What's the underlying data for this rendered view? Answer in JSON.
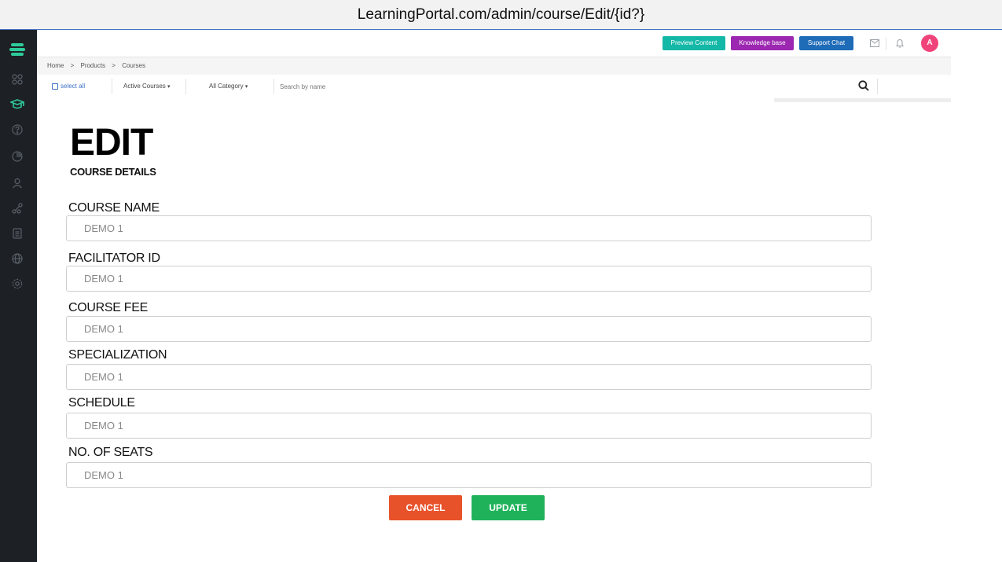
{
  "browser": {
    "url": "LearningPortal.com/admin/course/Edit/{id?}"
  },
  "sidebar": {
    "items": [
      {
        "icon": "menu-logo-icon"
      },
      {
        "icon": "dashboard-icon"
      },
      {
        "icon": "graduation-cap-icon"
      },
      {
        "icon": "help-icon"
      },
      {
        "icon": "chart-icon"
      },
      {
        "icon": "user-icon"
      },
      {
        "icon": "share-icon"
      },
      {
        "icon": "document-icon"
      },
      {
        "icon": "globe-icon"
      },
      {
        "icon": "settings-icon"
      }
    ],
    "accent": "#2ecc9a"
  },
  "topbar": {
    "preview_label": "Preview Content",
    "knowledge_label": "Knowledge base",
    "support_label": "Support Chat",
    "avatar_initial": "A",
    "colors": {
      "preview": "#14b8a6",
      "knowledge": "#9c27b0",
      "support": "#1e6bb8",
      "avatar": "#f0437a"
    }
  },
  "breadcrumb": {
    "items": [
      "Home",
      ">",
      "Products",
      ">",
      "Courses"
    ]
  },
  "filters": {
    "select_all": "select all",
    "active_courses": "Active Courses",
    "all_category": "All Category",
    "search_placeholder": "Search by name"
  },
  "page": {
    "title": "EDIT",
    "subtitle": "COURSE DETAILS"
  },
  "form": {
    "fields": [
      {
        "label": "COURSE NAME",
        "value": "DEMO 1"
      },
      {
        "label": "FACILITATOR ID",
        "value": "DEMO 1"
      },
      {
        "label": "COURSE FEE",
        "value": "DEMO 1"
      },
      {
        "label": "SPECIALIZATION",
        "value": "DEMO 1"
      },
      {
        "label": "SCHEDULE",
        "value": "DEMO 1"
      },
      {
        "label": "NO. OF SEATS",
        "value": "DEMO 1"
      }
    ],
    "cancel_label": "CANCEL",
    "update_label": "UPDATE",
    "colors": {
      "cancel": "#e8522a",
      "update": "#1fb25a"
    }
  }
}
